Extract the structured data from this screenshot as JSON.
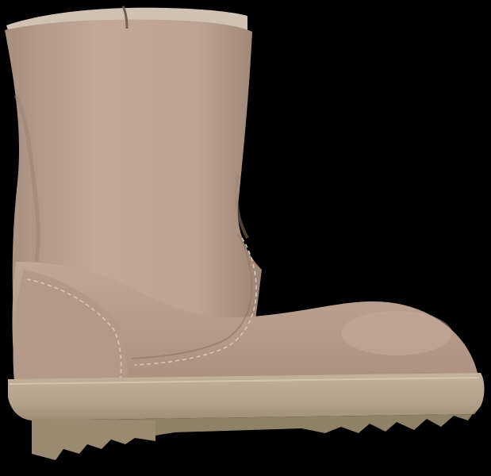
{
  "image": {
    "subject": "boot-product-photo",
    "background_color": "#000000",
    "colors": {
      "suede_light": "#c2a898",
      "suede_mid": "#b09686",
      "suede_dark": "#927a6c",
      "sole": "#b5a58f",
      "sole_dark": "#8f8068",
      "lining": "#cfc2b2",
      "stitch": "#d9c6b8"
    }
  }
}
